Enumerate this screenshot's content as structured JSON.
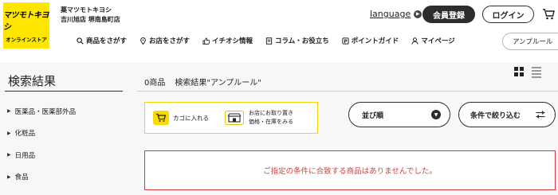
{
  "header": {
    "logo_line1": "マツモトキヨシ",
    "logo_line2": "オンラインストア",
    "store_name_line1": "薬マツモトキヨシ",
    "store_name_line2": "吉川旭店 堺南島町店",
    "language_label": "language",
    "register_label": "会員登録",
    "login_label": "ログイン",
    "search_value": "アンプルール"
  },
  "nav": {
    "items": [
      {
        "label": "商品をさがす",
        "icon": "search-icon"
      },
      {
        "label": "お店をさがす",
        "icon": "map-pin-icon"
      },
      {
        "label": "イチオシ情報",
        "icon": "thumbs-up-icon"
      },
      {
        "label": "コラム・お役立ち",
        "icon": "document-icon"
      },
      {
        "label": "ポイントガイド",
        "icon": "point-icon"
      },
      {
        "label": "マイページ",
        "icon": "user-icon"
      }
    ]
  },
  "sidebar": {
    "title": "検索結果",
    "items": [
      {
        "label": "医薬品・医薬部外品"
      },
      {
        "label": "化粧品"
      },
      {
        "label": "日用品"
      },
      {
        "label": "食品"
      }
    ]
  },
  "results": {
    "count": "0商品",
    "query_label": "検索結果\"アンプルール\""
  },
  "legend": {
    "cart_label": "カゴに入れる",
    "store_label_line1": "お店にお取り置き",
    "store_label_line2": "価格・在庫をみる"
  },
  "controls": {
    "sort_label": "並び順",
    "filter_label": "条件で絞り込む"
  },
  "message": {
    "no_result": "ご指定の条件に合致する商品はありませんでした。"
  },
  "colors": {
    "brand_yellow": "#ffe600",
    "dark": "#2d2d2d",
    "error_red": "#d93b3b"
  }
}
